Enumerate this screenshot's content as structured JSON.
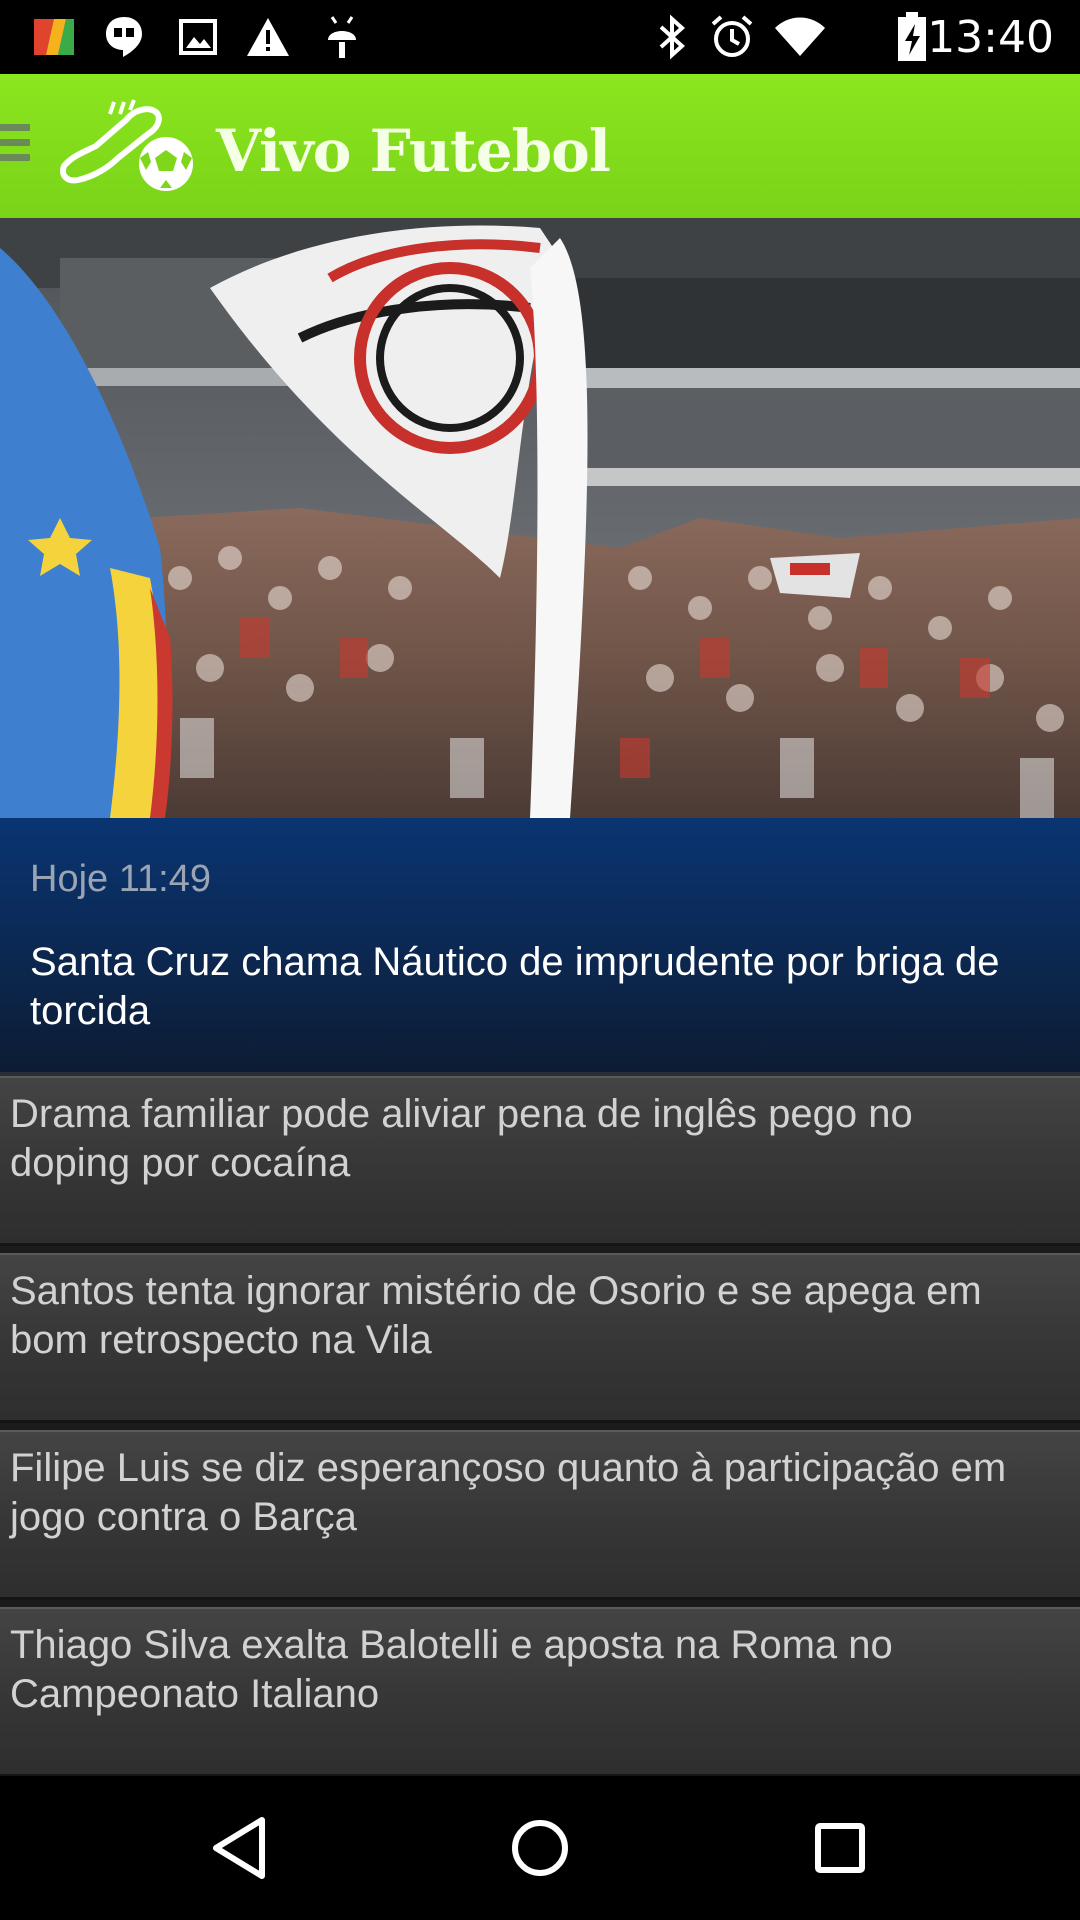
{
  "status_bar": {
    "time": "13:40",
    "left_icons": [
      "avg-antivirus-icon",
      "hangouts-icon",
      "gallery-icon",
      "warning-icon",
      "android-debug-icon"
    ],
    "right_icons": [
      "bluetooth-icon",
      "alarm-icon",
      "wifi-icon",
      "battery-charging-icon"
    ]
  },
  "app_bar": {
    "title": "Vivo Futebol",
    "accent_color": "#84dc1c"
  },
  "featured": {
    "time": "Hoje 11:49",
    "title": "Santa Cruz chama Náutico de imprudente por briga de torcida",
    "background_color": "#0b2a57"
  },
  "news": [
    {
      "title": "Drama familiar pode aliviar pena de inglês pego no doping por cocaína"
    },
    {
      "title": "Santos tenta ignorar mistério de Osorio e se apega em bom retrospecto na Vila"
    },
    {
      "title": "Filipe Luis se diz esperançoso quanto à participação em jogo contra o Barça"
    },
    {
      "title": "Thiago Silva exalta Balotelli e aposta na Roma no Campeonato Italiano"
    }
  ],
  "nav_bar": {
    "buttons": [
      "back-icon",
      "home-icon",
      "recents-icon"
    ]
  }
}
